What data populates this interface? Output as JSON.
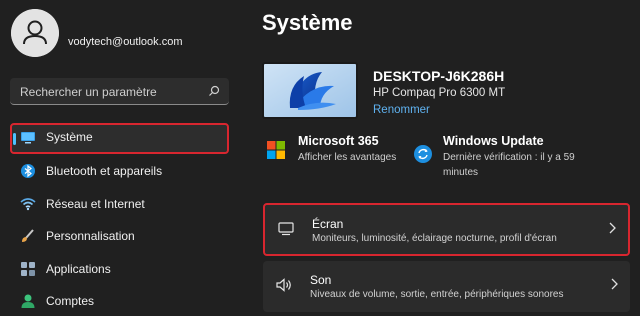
{
  "user": {
    "email": "vodytech@outlook.com"
  },
  "search": {
    "placeholder": "Rechercher un paramètre"
  },
  "sidebar": {
    "items": [
      {
        "label": "Système",
        "icon": "monitor-icon",
        "selected": true
      },
      {
        "label": "Bluetooth et appareils",
        "icon": "bluetooth-icon"
      },
      {
        "label": "Réseau et Internet",
        "icon": "wifi-icon"
      },
      {
        "label": "Personnalisation",
        "icon": "brush-icon"
      },
      {
        "label": "Applications",
        "icon": "apps-icon"
      },
      {
        "label": "Comptes",
        "icon": "person-icon"
      }
    ]
  },
  "main": {
    "title": "Système",
    "device": {
      "name": "DESKTOP-J6K286H",
      "model": "HP Compaq Pro 6300 MT",
      "rename": "Renommer"
    },
    "tiles": [
      {
        "title": "Microsoft 365",
        "subtitle": "Afficher les avantages",
        "icon": "microsoft-logo-icon"
      },
      {
        "title": "Windows Update",
        "subtitle_line1": "Dernière vérification : il y a 59",
        "subtitle_line2": "minutes",
        "icon": "windows-update-icon"
      }
    ],
    "cards": [
      {
        "title": "Écran",
        "subtitle": "Moniteurs, luminosité, éclairage nocturne, profil d'écran",
        "icon": "display-icon"
      },
      {
        "title": "Son",
        "subtitle": "Niveaux de volume, sortie, entrée, périphériques sonores",
        "icon": "speaker-icon"
      }
    ]
  },
  "colors": {
    "background": "#202020",
    "accent": "#4cc2ff",
    "highlight_border": "#d8262f",
    "link": "#5fb2f0"
  }
}
